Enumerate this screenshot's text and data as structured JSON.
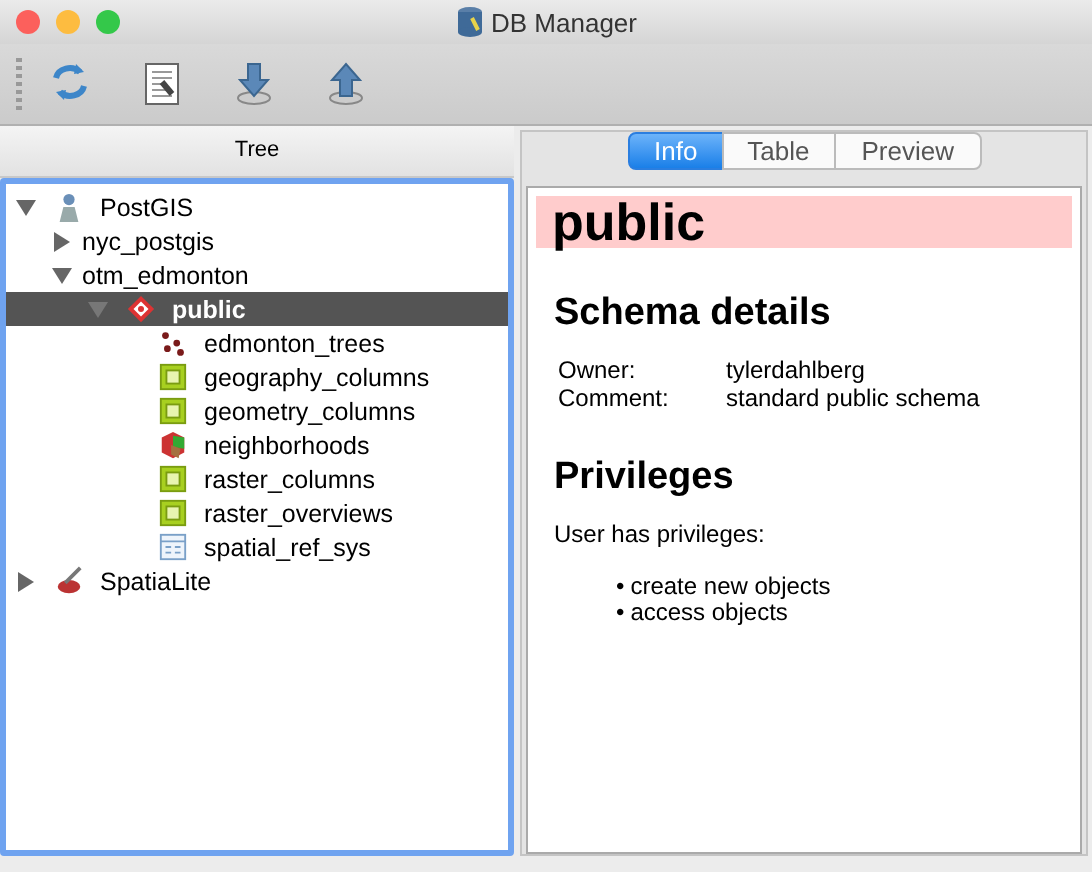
{
  "window": {
    "title": "DB Manager"
  },
  "toolbar": [
    {
      "kind": "refresh"
    },
    {
      "kind": "sql"
    },
    {
      "kind": "import"
    },
    {
      "kind": "export"
    }
  ],
  "tree": {
    "header": "Tree",
    "items": [
      {
        "label": "PostGIS",
        "kind": "postgis",
        "expanded": true,
        "selected": false,
        "children": [
          {
            "label": "nyc_postgis",
            "expanded": false,
            "selected": false
          },
          {
            "label": "otm_edmonton",
            "expanded": true,
            "selected": false,
            "children": [
              {
                "label": "public",
                "kind": "schema",
                "expanded": true,
                "selected": true,
                "children": [
                  {
                    "label": "edmonton_trees",
                    "kind": "points",
                    "selected": false
                  },
                  {
                    "label": "geography_columns",
                    "kind": "view",
                    "selected": false
                  },
                  {
                    "label": "geometry_columns",
                    "kind": "view",
                    "selected": false
                  },
                  {
                    "label": "neighborhoods",
                    "kind": "polygons",
                    "selected": false
                  },
                  {
                    "label": "raster_columns",
                    "kind": "view",
                    "selected": false
                  },
                  {
                    "label": "raster_overviews",
                    "kind": "view",
                    "selected": false
                  },
                  {
                    "label": "spatial_ref_sys",
                    "kind": "table",
                    "selected": false
                  }
                ]
              }
            ]
          }
        ]
      },
      {
        "label": "SpatiaLite",
        "kind": "spatialite",
        "expanded": false,
        "selected": false
      }
    ]
  },
  "tabs": [
    {
      "label": "Info",
      "selected": true
    },
    {
      "label": "Table",
      "selected": false
    },
    {
      "label": "Preview",
      "selected": false
    }
  ],
  "info": {
    "title": "public",
    "details_heading": "Schema details",
    "details": [
      {
        "label": "Owner:",
        "value": "tylerdahlberg"
      },
      {
        "label": "Comment:",
        "value": "standard public schema"
      }
    ],
    "privileges_heading": "Privileges",
    "privileges_text": "User has privileges:",
    "privileges": [
      {
        "bullet": "•",
        "text": "create new objects"
      },
      {
        "bullet": "•",
        "text": "access objects"
      }
    ]
  }
}
